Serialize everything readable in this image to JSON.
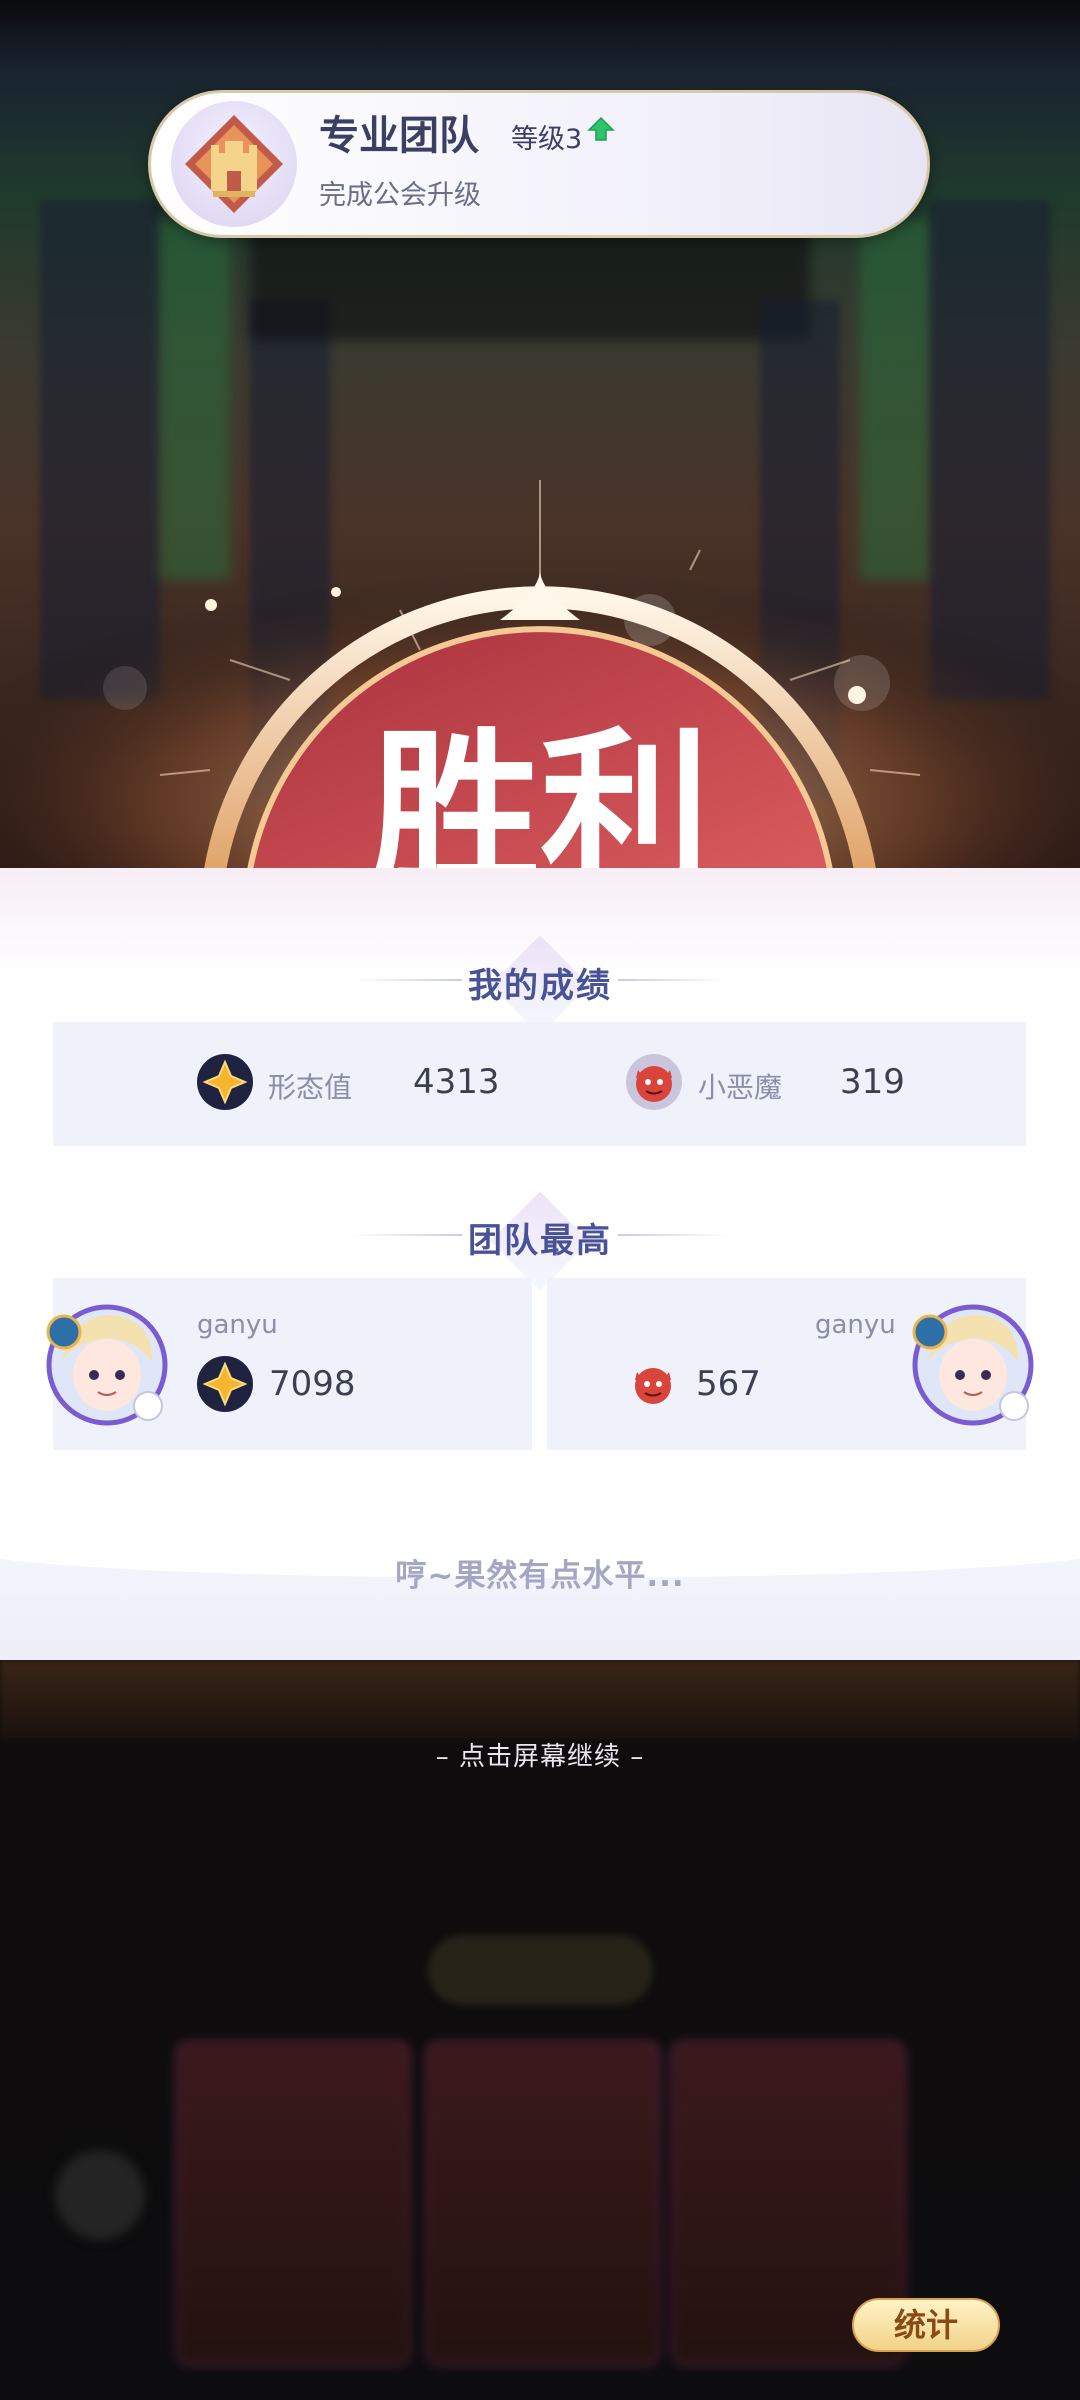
{
  "toast": {
    "title": "专业团队",
    "level": "等级3",
    "subtitle": "完成公会升级"
  },
  "victory": {
    "text": "胜利"
  },
  "my_score": {
    "title": "我的成绩",
    "items": [
      {
        "label": "形态值",
        "value": "4313",
        "icon": "star-emblem-icon"
      },
      {
        "label": "小恶魔",
        "value": "319",
        "icon": "little-devil-icon"
      }
    ]
  },
  "team_best": {
    "title": "团队最高",
    "players": [
      {
        "name": "ganyu",
        "value": "7098",
        "icon": "star-emblem-icon"
      },
      {
        "name": "ganyu",
        "value": "567",
        "icon": "little-devil-icon"
      }
    ]
  },
  "taunt": "哼~果然有点水平...",
  "tap_hint": "– 点击屏幕继续 –",
  "stats_button": "统计",
  "colors": {
    "title_blue": "#4a5297",
    "victory_red": "#c9444c",
    "gold": "#e9b96a"
  }
}
